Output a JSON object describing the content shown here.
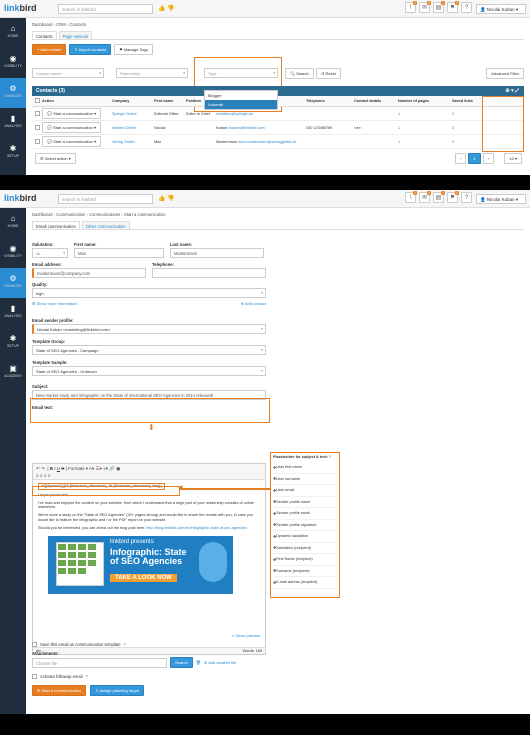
{
  "topbar": {
    "logo_a": "link",
    "logo_b": "bird",
    "search_placeholder": "search in linkbird",
    "user_name": "Nicolai Kuban",
    "badges": [
      "1",
      "2",
      "1",
      "2"
    ]
  },
  "sidebar": [
    {
      "label": "HOME",
      "icon": "home-icon",
      "glyph": "⌂"
    },
    {
      "label": "VISIBILITY",
      "icon": "eye-icon",
      "glyph": "◉"
    },
    {
      "label": "CHANCES",
      "icon": "chances-icon",
      "glyph": "⚙"
    },
    {
      "label": "ANALYSIS",
      "icon": "chart-icon",
      "glyph": "▮"
    },
    {
      "label": "SETUP",
      "icon": "gear-icon",
      "glyph": "✱"
    }
  ],
  "sidebar2": [
    {
      "label": "HOME",
      "icon": "home-icon",
      "glyph": "⌂"
    },
    {
      "label": "VISIBILITY",
      "icon": "eye-icon",
      "glyph": "◉"
    },
    {
      "label": "CHANCES",
      "icon": "chances-icon",
      "glyph": "⚙"
    },
    {
      "label": "ANALYSIS",
      "icon": "chart-icon",
      "glyph": "▮"
    },
    {
      "label": "SETUP",
      "icon": "gear-icon",
      "glyph": "✱"
    },
    {
      "label": "ACADEMY",
      "icon": "academy-icon",
      "glyph": "▣"
    }
  ],
  "contacts": {
    "breadcrumb": [
      "Dashboard",
      "CRM",
      "Contacts"
    ],
    "tabs": [
      "Contacts",
      "Page network"
    ],
    "buttons": {
      "add": "Add contact",
      "import": "Import contacts",
      "tags": "Manage Tags",
      "search": "Search",
      "reset": "Reset",
      "advanced": "Advanced Filter"
    },
    "filters": {
      "contact_owner": "Contact owner",
      "partnership": "Partnership",
      "tags": "Tags"
    },
    "tags_dropdown": [
      "Blogger",
      "Linkerati"
    ],
    "table_title": "Contacts (3)",
    "columns": [
      "Action",
      "Company",
      "First name",
      "Position",
      "Last name",
      "Email address",
      "Telephone",
      "Contact details",
      "Number of pages",
      "Saved links"
    ],
    "rows": [
      {
        "action": "Start a communication",
        "company": "Spiegel Online",
        "first": "Editorial Office",
        "position": "Editor in Chief",
        "last": "",
        "email": "redaktion@spiegel.de",
        "tel": "",
        "pages": "1",
        "links": "0"
      },
      {
        "action": "Start a communication",
        "company": "linkbird GmbH",
        "first": "Nicolai",
        "position": "",
        "last": "Kuban",
        "email": "nkuban@linkbird.com",
        "tel": "030 123456789",
        "pages": "1",
        "links": "0"
      },
      {
        "action": "Start a communication",
        "company": "Verlag GmbH",
        "first": "Max",
        "position": "",
        "last": "Mustermann",
        "email": "max.mustermann@verlaggmbh.de",
        "tel": "",
        "pages": "1",
        "links": "0"
      }
    ],
    "select_action": "Select action",
    "per_page": "10",
    "page": "1"
  },
  "comm": {
    "breadcrumb": [
      "Dashboard",
      "Communication",
      "Communications",
      "Start a communication"
    ],
    "tabs": [
      "Email communication",
      "Other communication"
    ],
    "labels": {
      "salutation": "Salutation:",
      "first": "First name:",
      "last": "Last name:",
      "email": "Email address:",
      "tel": "Telephone:",
      "quality": "Quality:",
      "more": "Show more information",
      "add_contact": "Add contact",
      "sender": "Email sender profile:",
      "group": "Template Group:",
      "sample": "Template Sample:",
      "subject": "Subject:",
      "text": "Email text:",
      "template": "Save this email as communication template",
      "attachments": "Attachments:",
      "choose": "Choose file",
      "search": "Search",
      "add_another": "Add another file",
      "followup": "Activate followup email",
      "start": "Start a communication",
      "assign": "Assign planning target",
      "preview": "Show preview"
    },
    "values": {
      "salutation": "Mr.",
      "first": "Max",
      "last": "Mustermann",
      "email": "mustermann@company.com",
      "tel": "",
      "quality": "high",
      "sender": "Nicolai Kuban <marketing@linkbird.com>",
      "group": "State of SEO Agencies - Campaign",
      "sample": "State of SEO Agencies - Outreach",
      "subject": "New market study and infographic on the State of International SEO Agencies in 2014 released!"
    },
    "editor": {
      "formats": "Formats",
      "greeting": "Hi{{dynamic}}{Hi {firstname_ofreceiver}, Hi {firstname_ofreceiver}, Hey}}",
      "p1": "I hope you're well,",
      "p2": "I've read and enjoyed the content on your website, from which I understand that a large part of your readership consists of online marketers.",
      "p3": "We've done a study on the \"State of SEO Agencies\" (30+ pages strong) and would like to share the results with you, in case you would like to feature the infographic and / or the PDF report on your website.",
      "p4": "Should you be interested, you can check out the blog post here:",
      "link": "http://blog.linkbird.com/en/infographic-state-of-seo-agencies",
      "banner_brand": "linkbird presents",
      "banner_title": "Infographic: State of SEO Agencies",
      "banner_cta": "TAKE A LOOK NOW",
      "footer_left": "div",
      "footer_right": "Words: 169"
    },
    "placeholders_title": "Placeholder for subject & text:",
    "placeholders": [
      "User first name",
      "User surname",
      "User email",
      "Sender profile name",
      "Sender profile email",
      "Sender profile signature",
      "Dynamic salutation",
      "Salutation (recipient)",
      "First Name (recipient)",
      "Surname (recipient)",
      "E-mail adress (recipient)"
    ]
  }
}
